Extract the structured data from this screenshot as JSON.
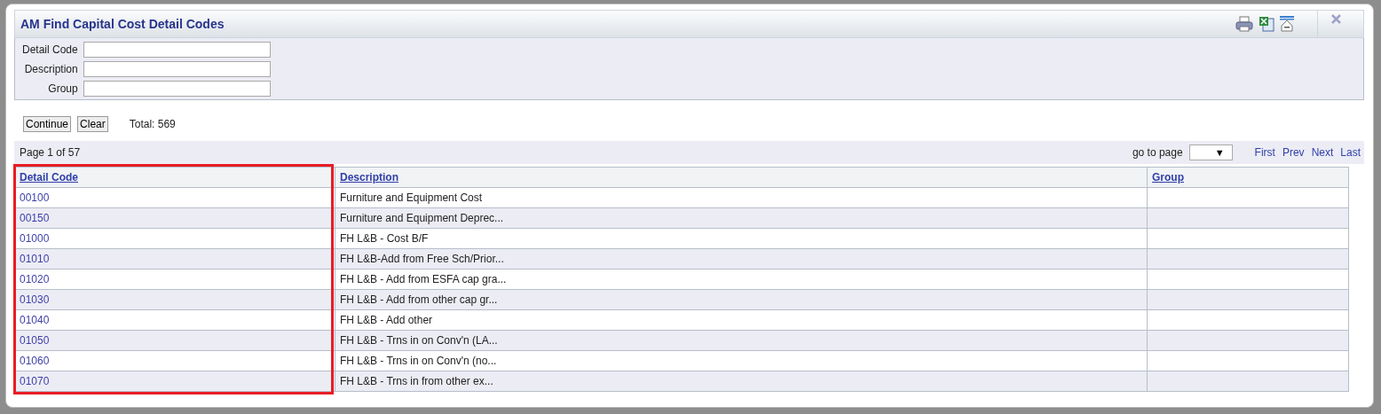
{
  "window": {
    "title": "AM Find Capital Cost Detail Codes"
  },
  "toolbar": [
    {
      "kind": "print"
    },
    {
      "kind": "excel"
    },
    {
      "kind": "collapse"
    },
    {
      "kind": "close"
    }
  ],
  "filters": [
    {
      "label": "Detail Code"
    },
    {
      "label": "Description"
    },
    {
      "label": "Group"
    }
  ],
  "buttons": [
    "Continue",
    "Clear"
  ],
  "total": "Total: 569",
  "pager": {
    "page": "Page 1 of 57",
    "go_to_label": "go to page",
    "select_icon": "▼",
    "links": [
      "First",
      "Prev",
      "Next",
      "Last"
    ]
  },
  "table": {
    "columns": [
      {
        "label": "Detail Code",
        "highlighted": true
      },
      {
        "label": "Description",
        "highlighted": false
      },
      {
        "label": "Group",
        "highlighted": false
      }
    ],
    "rows": [
      {
        "code": "00100",
        "description": "Furniture and Equipment Cost"
      },
      {
        "code": "00150",
        "description": "Furniture and Equipment Deprec..."
      },
      {
        "code": "01000",
        "description": "FH L&B - Cost B/F"
      },
      {
        "code": "01010",
        "description": "FH L&B-Add from Free Sch/Prior..."
      },
      {
        "code": "01020",
        "description": "FH L&B - Add from ESFA cap gra..."
      },
      {
        "code": "01030",
        "description": "FH L&B - Add from other cap gr..."
      },
      {
        "code": "01040",
        "description": "FH L&B - Add other"
      },
      {
        "code": "01050",
        "description": "FH L&B - Trns in on Conv'n (LA..."
      },
      {
        "code": "01060",
        "description": "FH L&B - Trns in on Conv'n (no..."
      },
      {
        "code": "01070",
        "description": "FH L&B - Trns in from other ex..."
      }
    ]
  }
}
